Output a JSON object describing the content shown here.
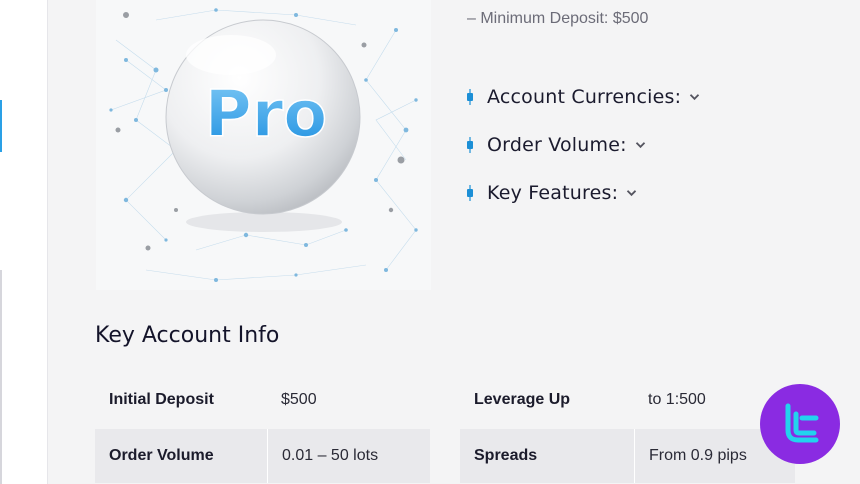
{
  "min_deposit_text": "– Minimum Deposit: $500",
  "hero": {
    "badge_text": "Pro"
  },
  "features": [
    {
      "label": "Account Currencies:",
      "icon": "chevron-down-icon"
    },
    {
      "label": "Order Volume:",
      "icon": "chevron-down-icon"
    },
    {
      "label": "Key Features:",
      "icon": "chevron-down-icon"
    }
  ],
  "section_title": "Key Account Info",
  "info_table": {
    "rows": [
      {
        "k1": "Initial Deposit",
        "v1": "$500",
        "k2": "Leverage Up",
        "v2": "to 1:500"
      },
      {
        "k1": "Order Volume",
        "v1": "0.01 – 50 lots",
        "k2": "Spreads",
        "v2": "From 0.9 pips"
      }
    ]
  },
  "colors": {
    "accent": "#2aa0e6",
    "logo_bg": "#8a2be2",
    "logo_fg": "#22d3ee"
  },
  "logo_icon": "tradingfinder-logo-icon"
}
